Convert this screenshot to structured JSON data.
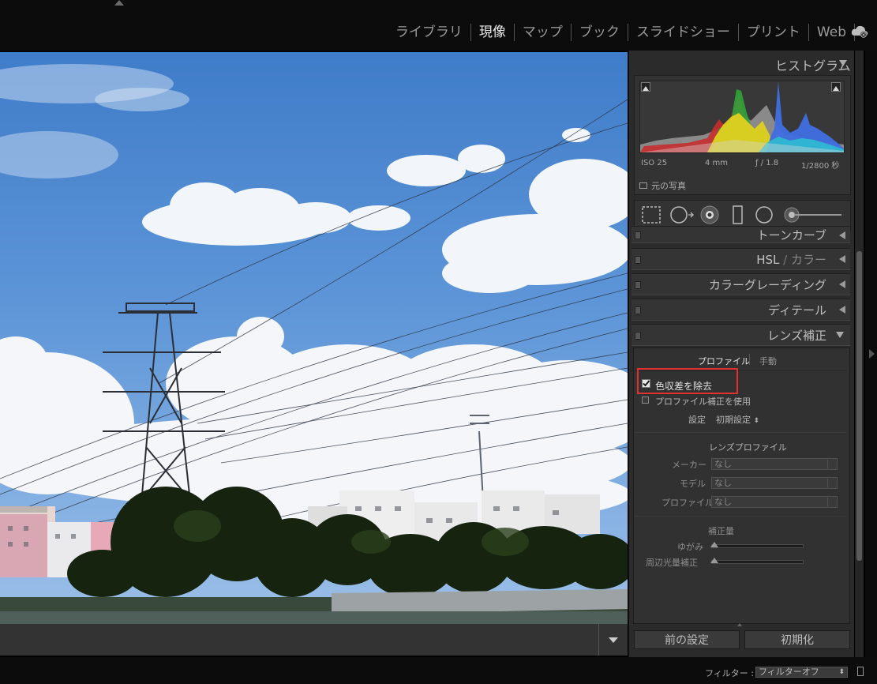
{
  "modules": {
    "items": [
      {
        "label": "ライブラリ",
        "active": false
      },
      {
        "label": "現像",
        "active": true
      },
      {
        "label": "マップ",
        "active": false
      },
      {
        "label": "ブック",
        "active": false
      },
      {
        "label": "スライドショー",
        "active": false
      },
      {
        "label": "プリント",
        "active": false
      },
      {
        "label": "Web",
        "active": false
      }
    ],
    "cloud_icon": "cloud-sync-icon"
  },
  "histogram": {
    "title": "ヒストグラム",
    "iso": "ISO 25",
    "focal": "4 mm",
    "aperture": "ƒ / 1.8",
    "shutter": "1/2800 秒",
    "original_photo": "元の写真"
  },
  "tools": [
    "crop-icon",
    "spot-removal-icon",
    "red-eye-icon",
    "graduated-filter-icon",
    "radial-filter-icon",
    "adjustment-brush-icon"
  ],
  "sections": {
    "tone_curve": "トーンカーブ",
    "hsl": "HSL",
    "hsl_sep": "/",
    "hsl_color": "カラー",
    "color_grading": "カラーグレーディング",
    "detail": "ディテール",
    "lens": "レンズ補正"
  },
  "lens": {
    "tab_profile": "プロファイル",
    "tab_manual": "手動",
    "remove_ca": "色収差を除去",
    "remove_ca_checked": true,
    "enable_profile": "プロファイル補正を使用",
    "enable_profile_checked": false,
    "setting_label": "設定",
    "setting_value": "初期設定",
    "lens_profile_heading": "レンズプロファイル",
    "maker_label": "メーカー",
    "maker_value": "なし",
    "model_label": "モデル",
    "model_value": "なし",
    "profile_label": "プロファイル",
    "profile_value": "なし",
    "amount_heading": "補正量",
    "distortion_label": "ゆがみ",
    "vignetting_label": "周辺光量補正"
  },
  "buttons": {
    "previous": "前の設定",
    "reset": "初期化"
  },
  "filter": {
    "label": "フィルター :",
    "value": "フィルターオフ"
  }
}
